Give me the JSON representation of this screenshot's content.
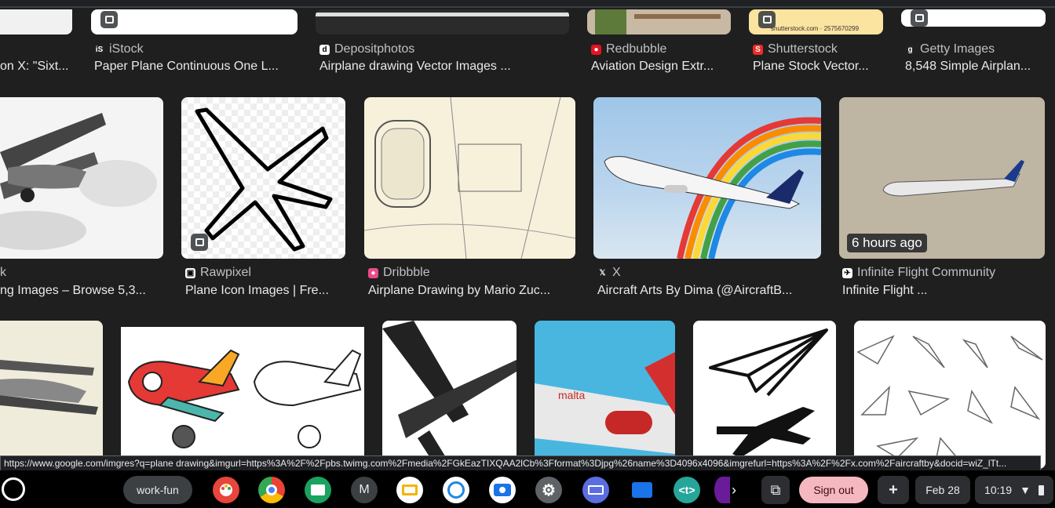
{
  "row1": [
    {
      "source": "",
      "title": "on X: \"Sixt..."
    },
    {
      "source": "iStock",
      "title": "Paper Plane Continuous One L..."
    },
    {
      "source": "Depositphotos",
      "title": "Airplane drawing Vector Images ..."
    },
    {
      "source": "Redbubble",
      "title": "Aviation Design Extr..."
    },
    {
      "source": "Shutterstock",
      "title": "Plane Stock Vector..."
    },
    {
      "source": "Getty Images",
      "title": "8,548 Simple Airplan..."
    }
  ],
  "row1_overlay": {
    "shutterstock_caption": "shutterstock.com · 2575670299"
  },
  "row2": [
    {
      "source": "k",
      "title": "ng Images – Browse 5,3..."
    },
    {
      "source": "Rawpixel",
      "title": "Plane Icon Images | Fre..."
    },
    {
      "source": "Dribbble",
      "title": "Airplane Drawing by Mario Zuc..."
    },
    {
      "source": "X",
      "title": "Aircraft Arts By Dima (@AircraftB..."
    },
    {
      "source": "Infinite Flight Community",
      "title": "Infinite Flight ..."
    }
  ],
  "time_badge": "6 hours ago",
  "status_url": "https://www.google.com/imgres?q=plane drawing&imgurl=https%3A%2F%2Fpbs.twimg.com%2Fmedia%2FGkEazTIXQAA2lCb%3Fformat%3Djpg%26name%3D4096x4096&imgrefurl=https%3A%2F%2Fx.com%2Faircraftby&docid=wiZ_lTt...",
  "shelf": {
    "desk_label": "work-fun",
    "apps": [
      {
        "name": "palette-app-icon",
        "glyph": "🎨",
        "color": "#e8453c"
      },
      {
        "name": "chrome-icon",
        "glyph": "",
        "color": "#ffffff"
      },
      {
        "name": "classroom-icon",
        "glyph": "",
        "color": "#1aa260"
      },
      {
        "name": "gmail-m-icon",
        "glyph": "M",
        "color": "#3c4043"
      },
      {
        "name": "slides-icon",
        "glyph": "",
        "color": "#f4b400"
      },
      {
        "name": "globe-app-icon",
        "glyph": "",
        "color": "#1e88e5"
      },
      {
        "name": "camera-icon",
        "glyph": "",
        "color": "#1a73e8"
      },
      {
        "name": "settings-gear-icon",
        "glyph": "⚙",
        "color": "#5f6368"
      },
      {
        "name": "keyboard-app-icon",
        "glyph": "",
        "color": "#5b6ee1"
      },
      {
        "name": "files-icon",
        "glyph": "",
        "color": "#1a73e8"
      },
      {
        "name": "text-app-icon",
        "glyph": "<t>",
        "color": "#26a69a"
      }
    ],
    "sign_out": "Sign out",
    "date": "Feb 28",
    "time": "10:19"
  }
}
